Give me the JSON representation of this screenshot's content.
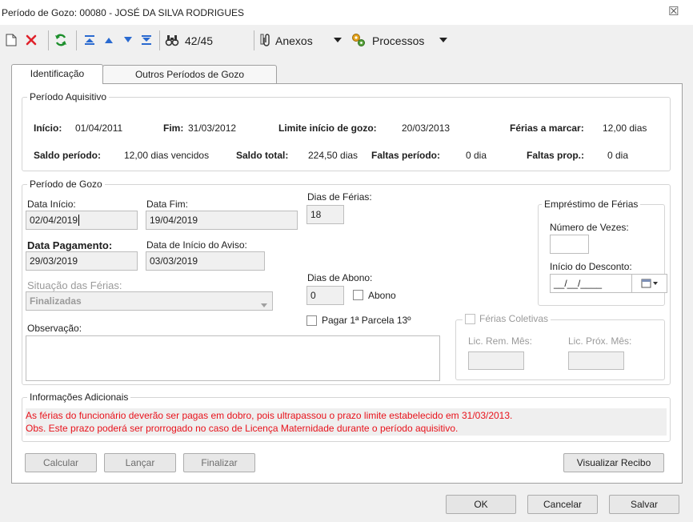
{
  "window": {
    "title": "Período de Gozo: 00080 - JOSÉ DA SILVA RODRIGUES",
    "close_glyph": "☒"
  },
  "toolbar": {
    "record_position": "42/45",
    "anexos_label": "Anexos",
    "processos_label": "Processos"
  },
  "tabs": [
    "Identificação",
    "Outros Períodos de Gozo"
  ],
  "periodo_aquisitivo": {
    "title": "Período Aquisitivo",
    "inicio_label": "Início:",
    "inicio_value": "01/04/2011",
    "fim_label": "Fim:",
    "fim_value": "31/03/2012",
    "limite_label": "Limite início de gozo:",
    "limite_value": "20/03/2013",
    "ferias_marcar_label": "Férias a marcar:",
    "ferias_marcar_value": "12,00 dias",
    "saldo_periodo_label": "Saldo período:",
    "saldo_periodo_value": "12,00 dias vencidos",
    "saldo_total_label": "Saldo total:",
    "saldo_total_value": "224,50 dias",
    "faltas_periodo_label": "Faltas período:",
    "faltas_periodo_value": "0 dia",
    "faltas_prop_label": "Faltas prop.:",
    "faltas_prop_value": "0 dia"
  },
  "periodo_gozo": {
    "title": "Período de Gozo",
    "data_inicio_label": "Data Início:",
    "data_inicio_value": "02/04/2019",
    "data_fim_label": "Data Fim:",
    "data_fim_value": "19/04/2019",
    "dias_ferias_label": "Dias de Férias:",
    "dias_ferias_value": "18",
    "data_pagamento_label": "Data Pagamento:",
    "data_pagamento_value": "29/03/2019",
    "data_aviso_label": "Data de Início do Aviso:",
    "data_aviso_value": "03/03/2019",
    "situacao_label": "Situação das Férias:",
    "situacao_value": "Finalizadas",
    "dias_abono_label": "Dias de Abono:",
    "dias_abono_value": "0",
    "abono_label": "Abono",
    "pagar_13_label": "Pagar 1ª Parcela 13º",
    "observacao_label": "Observação:",
    "observacao_value": ""
  },
  "emprestimo": {
    "title": "Empréstimo de Férias",
    "numero_vezes_label": "Número de Vezes:",
    "numero_vezes_value": "",
    "inicio_desconto_label": "Início do Desconto:",
    "inicio_desconto_value": "__/__/____"
  },
  "ferias_coletivas": {
    "title": "Férias Coletivas",
    "lic_rem_label": "Lic. Rem. Mês:",
    "lic_prox_label": "Lic. Próx. Mês:"
  },
  "informacoes": {
    "title": "Informações Adicionais",
    "line1": "As férias do funcionário deverão ser pagas em dobro, pois ultrapassou o prazo limite estabelecido em 31/03/2013.",
    "line2": "Obs. Este prazo poderá ser prorrogado no caso de Licença Maternidade durante o período aquisitivo."
  },
  "actions": {
    "calcular": "Calcular",
    "lancar": "Lançar",
    "finalizar": "Finalizar",
    "visualizar_recibo": "Visualizar Recibo"
  },
  "footer": {
    "ok": "OK",
    "cancelar": "Cancelar",
    "salvar": "Salvar"
  },
  "colors": {
    "warning_text": "#e8121b",
    "panel_bg": "#ffffff",
    "window_bg": "#f0f0f0"
  }
}
